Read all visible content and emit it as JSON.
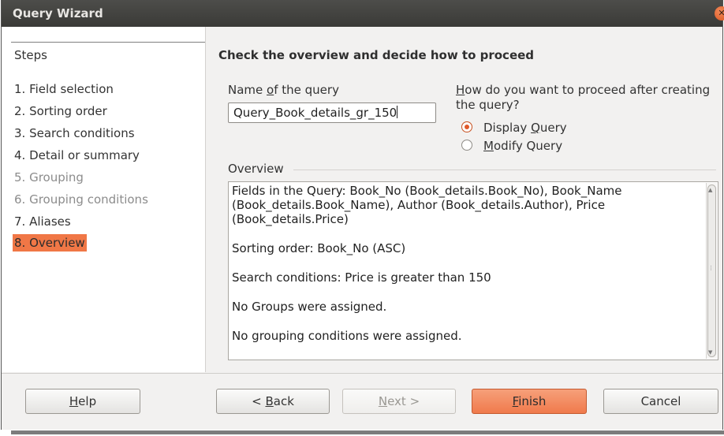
{
  "window": {
    "title": "Query Wizard"
  },
  "sidebar": {
    "heading": "Steps",
    "steps": [
      {
        "label": "1. Field selection",
        "state": "normal"
      },
      {
        "label": "2. Sorting order",
        "state": "normal"
      },
      {
        "label": "3. Search conditions",
        "state": "normal"
      },
      {
        "label": "4. Detail or summary",
        "state": "normal"
      },
      {
        "label": "5. Grouping",
        "state": "disabled"
      },
      {
        "label": "6. Grouping conditions",
        "state": "disabled"
      },
      {
        "label": "7. Aliases",
        "state": "normal"
      },
      {
        "label": "8. Overview",
        "state": "active"
      }
    ]
  },
  "main": {
    "heading": "Check the overview and decide how to proceed",
    "name_label_pre": "Name ",
    "name_label_mnemonic": "o",
    "name_label_post": "f the query",
    "name_value": "Query_Book_details_gr_150",
    "proceed_label_mnemonic": "H",
    "proceed_label_line1_rest": "ow do you want to proceed after creating",
    "proceed_label_line2": "the query?",
    "options": [
      {
        "pre": "Display ",
        "mnemonic": "Q",
        "post": "uery",
        "selected": true
      },
      {
        "pre": "",
        "mnemonic": "M",
        "post": "odify Query",
        "selected": false
      }
    ],
    "overview_label": "Overview",
    "overview_paragraphs": [
      "Fields in the Query: Book_No (Book_details.Book_No), Book_Name (Book_details.Book_Name), Author (Book_details.Author), Price (Book_details.Price)",
      "Sorting order: Book_No (ASC)",
      "Search conditions: Price is greater than 150",
      "No Groups were assigned.",
      "No grouping conditions were assigned."
    ]
  },
  "buttons": {
    "help": {
      "mnemonic": "H",
      "rest": "elp"
    },
    "back": {
      "pre": "< ",
      "mnemonic": "B",
      "rest": "ack"
    },
    "next": {
      "mnemonic": "N",
      "rest": "ext >"
    },
    "finish": {
      "mnemonic": "F",
      "rest": "inish"
    },
    "cancel": {
      "label": "Cancel"
    }
  },
  "colors": {
    "accent": "#f07746",
    "titlebar": "#3c3b37"
  }
}
